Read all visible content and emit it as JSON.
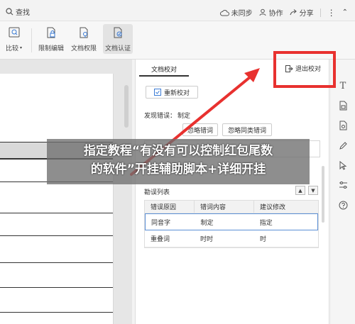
{
  "topbar": {
    "search_label": "查找",
    "sync_label": "未同步",
    "collab_label": "协作",
    "share_label": "分享"
  },
  "ribbon": {
    "compare_label": "比较",
    "restrict_label": "限制编辑",
    "permission_label": "文档权限",
    "certify_label": "文档认证"
  },
  "panel": {
    "tab_label": "文档校对",
    "exit_label": "退出校对",
    "recheck_label": "重新校对",
    "found_label": "发现错误：",
    "found_value": "制定",
    "ignore_label": "忽略错词",
    "ignore_similar_label": "忽略同类错词",
    "error_list_title": "勘误列表",
    "columns": [
      "错误原因",
      "错词内容",
      "建议修改"
    ],
    "rows": [
      {
        "reason": "同音字",
        "word": "制定",
        "suggest": "指定"
      },
      {
        "reason": "重叠词",
        "word": "时时",
        "suggest": "时"
      }
    ]
  },
  "banner": {
    "line1": "指定教程“有没有可以控制红包尾数",
    "line2": "的软件”开挂辅助脚本+详细开挂"
  },
  "colors": {
    "highlight": "#e8312f",
    "accent": "#5b8fd6"
  }
}
